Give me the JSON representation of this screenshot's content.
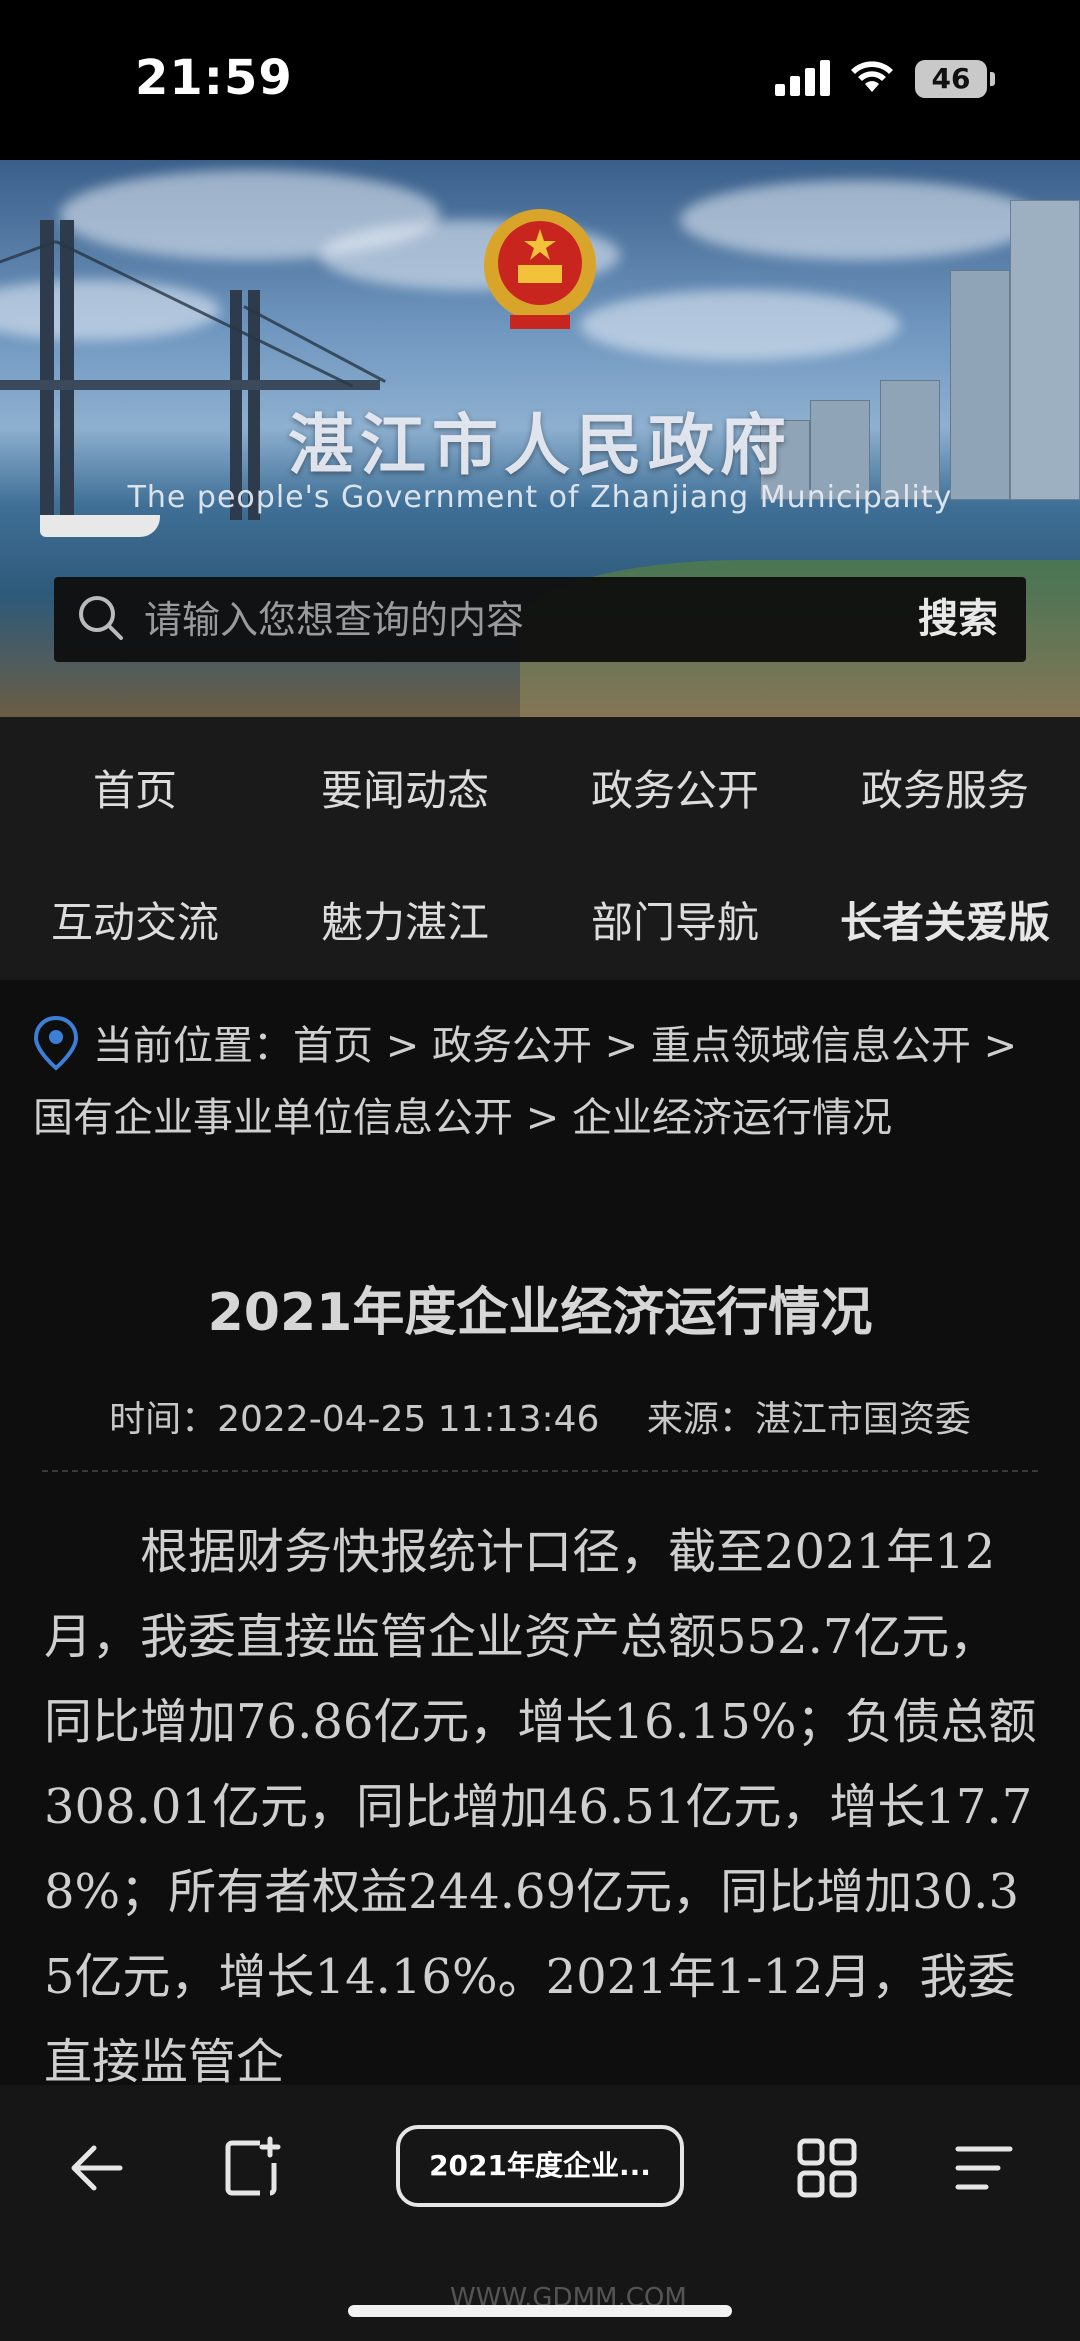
{
  "status_bar": {
    "time": "21:59",
    "battery": "46"
  },
  "banner": {
    "title": "湛江市人民政府",
    "subtitle": "The people's Government of Zhanjiang Municipality",
    "search_placeholder": "请输入您想查询的内容",
    "search_button": "搜索"
  },
  "nav": {
    "items": [
      {
        "label": "首页"
      },
      {
        "label": "要闻动态"
      },
      {
        "label": "政务公开"
      },
      {
        "label": "政务服务"
      },
      {
        "label": "互动交流"
      },
      {
        "label": "魅力湛江"
      },
      {
        "label": "部门导航"
      },
      {
        "label": "长者关爱版"
      }
    ]
  },
  "breadcrumb": {
    "text": "当前位置：首页 > 政务公开 > 重点领域信息公开 > 国有企业事业单位信息公开 > 企业经济运行情况"
  },
  "article": {
    "title": "2021年度企业经济运行情况",
    "time": "时间：2022-04-25 11:13:46",
    "source": "来源：湛江市国资委",
    "body": "根据财务快报统计口径，截至2021年12月，我委直接监管企业资产总额552.7亿元，同比增加76.86亿元，增长16.15%；负债总额308.01亿元，同比增加46.51亿元，增长17.78%；所有者权益244.69亿元，同比增加30.35亿元，增长14.16%。2021年1-12月，我委直接监管企"
  },
  "toolbar": {
    "tab_label": "2021年度企业..."
  },
  "watermark": "WWW.GDMM.COM"
}
